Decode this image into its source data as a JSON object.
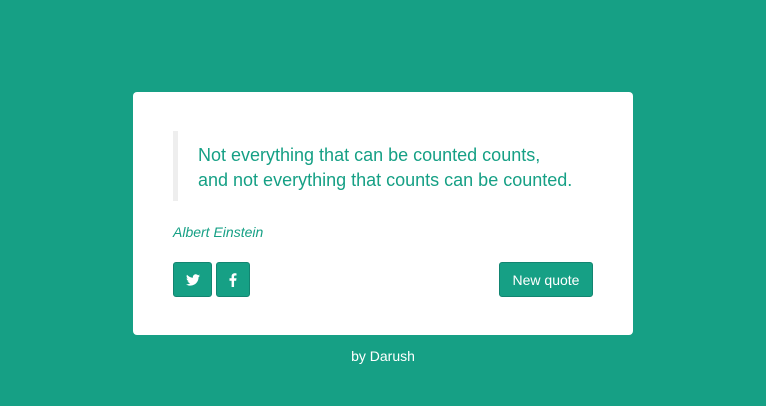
{
  "quote": {
    "text": "Not everything that can be counted counts, and not everything that counts can be counted.",
    "author": "Albert Einstein"
  },
  "buttons": {
    "twitter_icon": "twitter-icon",
    "facebook_icon": "facebook-icon",
    "new_quote_label": "New quote"
  },
  "footer": {
    "credit": "by Darush"
  },
  "colors": {
    "accent": "#16a085",
    "card_background": "#ffffff",
    "quote_border": "#eeeeee"
  }
}
